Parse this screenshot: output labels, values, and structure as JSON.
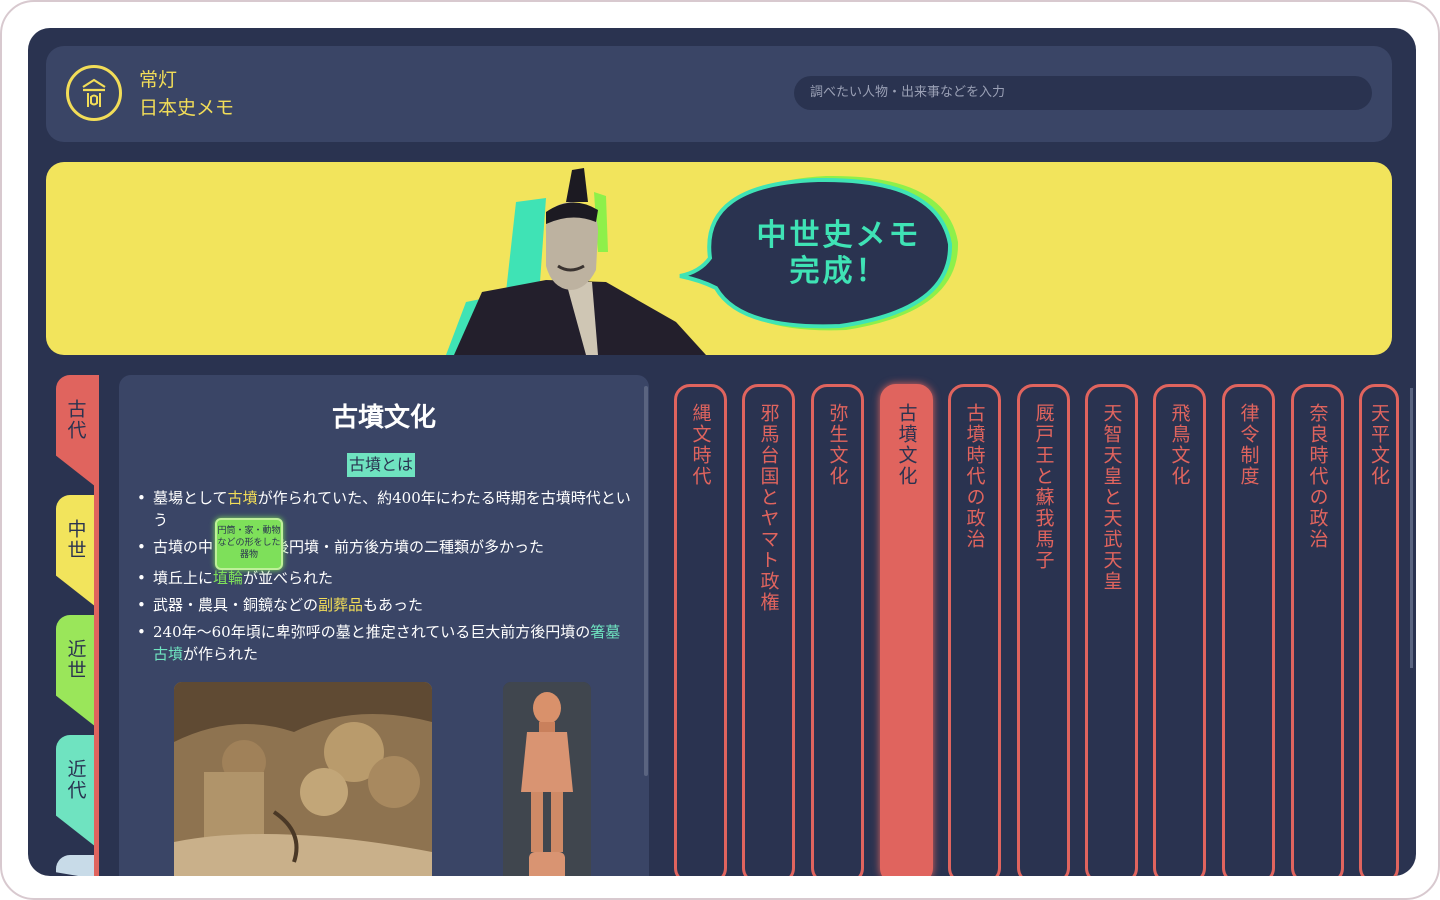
{
  "header": {
    "logo_line1": "常灯",
    "logo_line2": "日本史メモ",
    "search_placeholder": "調べたい人物・出来事などを入力"
  },
  "banner": {
    "bubble_line1": "中世史メモ",
    "bubble_line2": "完成！"
  },
  "eras": [
    {
      "label": "古代",
      "color": "#e0645e"
    },
    {
      "label": "中世",
      "color": "#f2e45c"
    },
    {
      "label": "近世",
      "color": "#9ae65a"
    },
    {
      "label": "近代",
      "color": "#6fe3c0"
    },
    {
      "label": "",
      "color": "#c8dbe8"
    }
  ],
  "panel": {
    "title": "古墳文化",
    "subtitle": "古墳とは",
    "b1_pre": "墓場として",
    "b1_hl": "古墳",
    "b1_post": "が作られていた、約400年にわたる時期を古墳時代という",
    "b2_pre": "古墳の中",
    "b2_post": "方後円墳・前方後方墳の二種類が多かった",
    "b3_pre": "墳丘上に",
    "b3_hl": "埴輪",
    "b3_post": "が並べられた",
    "b4_pre": "武器・農具・銅鏡などの",
    "b4_hl": "副葬品",
    "b4_post": "もあった",
    "b5_pre": "240年〜60年頃に卑弥呼の墓と推定されている巨大前方後円墳の",
    "b5_hl": "箸墓古墳",
    "b5_post": "が作られた",
    "tooltip": "円筒・家・動物などの形をした器物"
  },
  "topics": [
    "縄文時代",
    "邪馬台国とヤマト政権",
    "弥生文化",
    "古墳文化",
    "古墳時代の政治",
    "厩戸王と蘇我馬子",
    "天智天皇と天武天皇",
    "飛鳥文化",
    "律令制度",
    "奈良時代の政治",
    "天平文化"
  ],
  "active_topic": "古墳文化",
  "colors": {
    "background": "#2a3350",
    "panel": "#3a4566",
    "accent_yellow": "#f2e45c",
    "accent_red": "#e0645e",
    "accent_teal": "#6fe3c0",
    "accent_green": "#7ee05a"
  },
  "icons": [
    "lantern-icon"
  ]
}
